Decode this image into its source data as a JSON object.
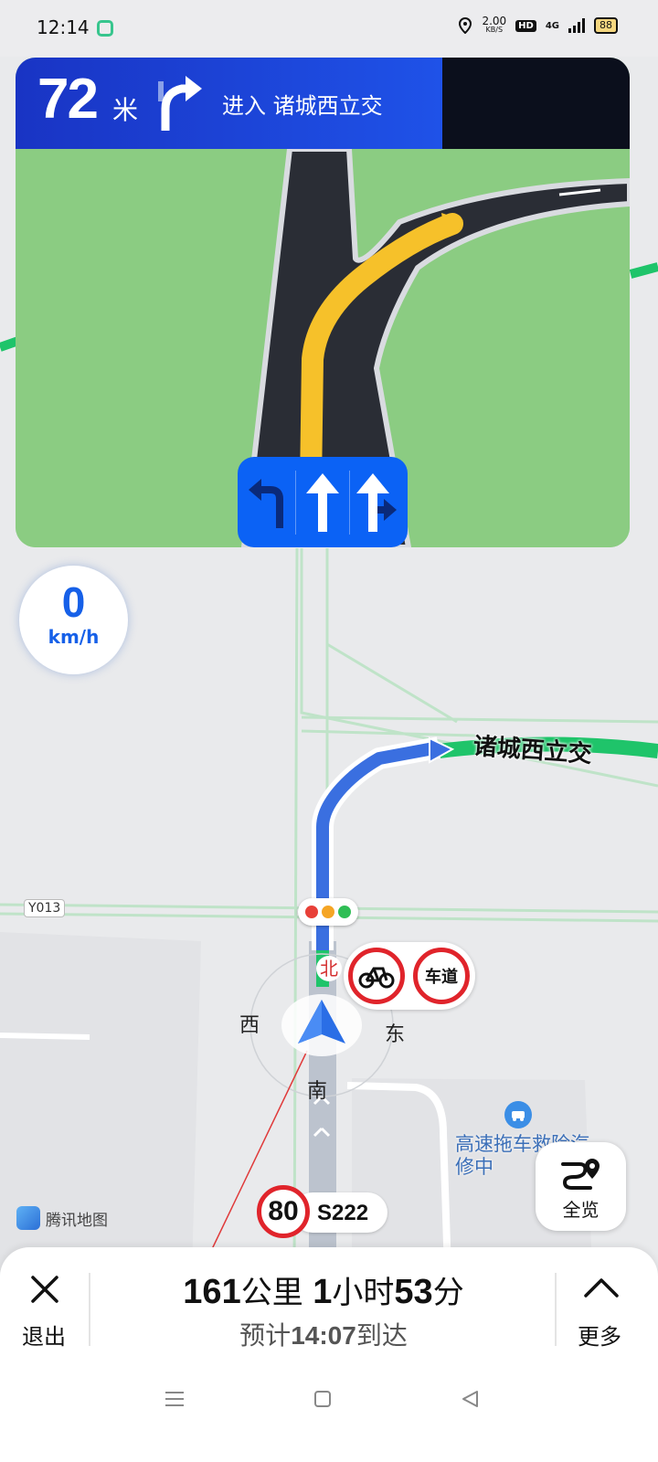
{
  "status_bar": {
    "time": "12:14",
    "net_speed_value": "2.00",
    "net_speed_unit": "KB/S",
    "hd": "HD",
    "network": "4G",
    "battery": "88"
  },
  "guidance": {
    "distance": "72",
    "distance_unit": "米",
    "instruction": "进入 诸城西立交",
    "turn_icon": "turn-right-arrow-icon",
    "lanes": [
      {
        "icon": "turn-left-icon",
        "active": false
      },
      {
        "icon": "straight-icon",
        "active": true
      },
      {
        "icon": "straight-or-right-icon",
        "active": true
      }
    ]
  },
  "speed": {
    "value": "0",
    "unit": "km/h"
  },
  "map": {
    "junction_label": "诸城西立交",
    "road_label": "Y013",
    "compass": {
      "north": "北",
      "south": "南",
      "east": "东",
      "west": "西"
    },
    "restriction_sign_text": "车道",
    "poi_name": "高速拖车救险汽修中",
    "speed_limit": "80",
    "current_road": "S222",
    "map_logo": "腾讯地图",
    "colors": {
      "route": "#2f6fe0",
      "road_green": "#1fc46a",
      "grass": "#8bcc82"
    }
  },
  "controls": {
    "overview_label": "全览",
    "exit_label": "退出",
    "more_label": "更多"
  },
  "trip": {
    "distance_value": "161",
    "distance_unit": "公里",
    "hours_value": "1",
    "hours_unit": "小时",
    "minutes_value": "53",
    "minutes_unit": "分",
    "eta_prefix": "预计",
    "eta_time": "14:07",
    "eta_suffix": "到达"
  }
}
